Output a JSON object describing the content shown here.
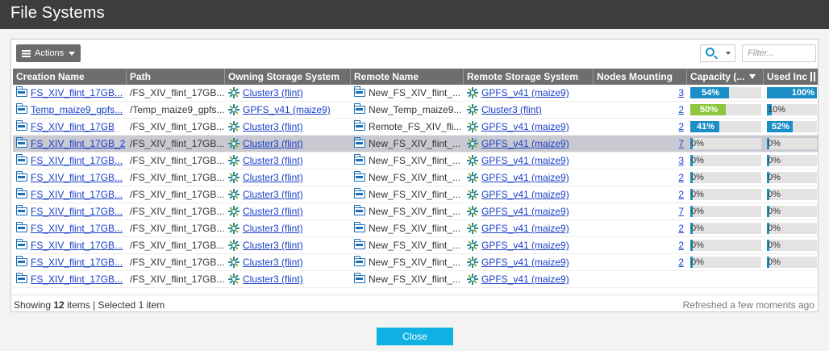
{
  "window": {
    "title": "File Systems"
  },
  "toolbar": {
    "actions_label": "Actions",
    "filter_placeholder": "Filter..."
  },
  "columns": [
    "Creation Name",
    "Path",
    "Owning Storage System",
    "Remote Name",
    "Remote Storage System",
    "Nodes Mounting",
    "Capacity (...",
    "Used Inc"
  ],
  "rows": [
    {
      "creation_name": "FS_XIV_flint_17GB...",
      "path": "/FS_XIV_flint_17GB...",
      "owning_system": "Cluster3 (flint)",
      "remote_name": "New_FS_XIV_flint_...",
      "remote_system": "GPFS_v41 (maize9)",
      "nodes_mounting": "3",
      "capacity_pct": 54,
      "capacity_label": "54%",
      "used_inc_pct": 100,
      "used_inc_label": "100%",
      "selected": false
    },
    {
      "creation_name": "Temp_maize9_gpfs...",
      "path": "/Temp_maize9_gpfs...",
      "owning_system": "GPFS_v41 (maize9)",
      "remote_name": "New_Temp_maize9...",
      "remote_system": "Cluster3 (flint)",
      "nodes_mounting": "2",
      "capacity_pct": 50,
      "capacity_label": "50%",
      "used_inc_pct": 10,
      "used_inc_label": "10%",
      "selected": false
    },
    {
      "creation_name": "FS_XIV_flint_17GB",
      "path": "/FS_XIV_flint_17GB...",
      "owning_system": "Cluster3 (flint)",
      "remote_name": "Remote_FS_XIV_fli...",
      "remote_system": "GPFS_v41 (maize9)",
      "nodes_mounting": "2",
      "capacity_pct": 41,
      "capacity_label": "41%",
      "used_inc_pct": 52,
      "used_inc_label": "52%",
      "selected": false
    },
    {
      "creation_name": "FS_XIV_flint_17GB_2",
      "path": "/FS_XIV_flint_17GB...",
      "owning_system": "Cluster3 (flint)",
      "remote_name": "New_FS_XIV_flint_...",
      "remote_system": "GPFS_v41 (maize9)",
      "nodes_mounting": "7",
      "capacity_pct": 2,
      "capacity_label": "0%",
      "used_inc_pct": 2,
      "used_inc_label": "0%",
      "selected": true
    },
    {
      "creation_name": "FS_XIV_flint_17GB...",
      "path": "/FS_XIV_flint_17GB...",
      "owning_system": "Cluster3 (flint)",
      "remote_name": "New_FS_XIV_flint_...",
      "remote_system": "GPFS_v41 (maize9)",
      "nodes_mounting": "3",
      "capacity_pct": 2,
      "capacity_label": "0%",
      "used_inc_pct": 2,
      "used_inc_label": "0%",
      "selected": false
    },
    {
      "creation_name": "FS_XIV_flint_17GB...",
      "path": "/FS_XIV_flint_17GB...",
      "owning_system": "Cluster3 (flint)",
      "remote_name": "New_FS_XIV_flint_...",
      "remote_system": "GPFS_v41 (maize9)",
      "nodes_mounting": "2",
      "capacity_pct": 2,
      "capacity_label": "0%",
      "used_inc_pct": 2,
      "used_inc_label": "0%",
      "selected": false
    },
    {
      "creation_name": "FS_XIV_flint_17GB...",
      "path": "/FS_XIV_flint_17GB...",
      "owning_system": "Cluster3 (flint)",
      "remote_name": "New_FS_XIV_flint_...",
      "remote_system": "GPFS_v41 (maize9)",
      "nodes_mounting": "2",
      "capacity_pct": 2,
      "capacity_label": "0%",
      "used_inc_pct": 2,
      "used_inc_label": "0%",
      "selected": false
    },
    {
      "creation_name": "FS_XIV_flint_17GB...",
      "path": "/FS_XIV_flint_17GB...",
      "owning_system": "Cluster3 (flint)",
      "remote_name": "New_FS_XIV_flint_...",
      "remote_system": "GPFS_v41 (maize9)",
      "nodes_mounting": "7",
      "capacity_pct": 2,
      "capacity_label": "0%",
      "used_inc_pct": 2,
      "used_inc_label": "0%",
      "selected": false
    },
    {
      "creation_name": "FS_XIV_flint_17GB...",
      "path": "/FS_XIV_flint_17GB...",
      "owning_system": "Cluster3 (flint)",
      "remote_name": "New_FS_XIV_flint_...",
      "remote_system": "GPFS_v41 (maize9)",
      "nodes_mounting": "2",
      "capacity_pct": 2,
      "capacity_label": "0%",
      "used_inc_pct": 2,
      "used_inc_label": "0%",
      "selected": false
    },
    {
      "creation_name": "FS_XIV_flint_17GB...",
      "path": "/FS_XIV_flint_17GB...",
      "owning_system": "Cluster3 (flint)",
      "remote_name": "New_FS_XIV_flint_...",
      "remote_system": "GPFS_v41 (maize9)",
      "nodes_mounting": "2",
      "capacity_pct": 2,
      "capacity_label": "0%",
      "used_inc_pct": 2,
      "used_inc_label": "0%",
      "selected": false
    },
    {
      "creation_name": "FS_XIV_flint_17GB...",
      "path": "/FS_XIV_flint_17GB...",
      "owning_system": "Cluster3 (flint)",
      "remote_name": "New_FS_XIV_flint_...",
      "remote_system": "GPFS_v41 (maize9)",
      "nodes_mounting": "2",
      "capacity_pct": 2,
      "capacity_label": "0%",
      "used_inc_pct": 2,
      "used_inc_label": "0%",
      "selected": false
    },
    {
      "creation_name": "FS_XIV_flint_17GB...",
      "path": "/FS_XIV_flint_17GB...",
      "owning_system": "Cluster3 (flint)",
      "remote_name": "New_FS_XIV_flint_...",
      "remote_system": "GPFS_v41 (maize9)",
      "nodes_mounting": "",
      "capacity_pct": null,
      "capacity_label": "",
      "used_inc_pct": null,
      "used_inc_label": "",
      "selected": false
    }
  ],
  "footer": {
    "showing_prefix": "Showing",
    "item_count": "12",
    "items_suffix": "items | Selected 1 item",
    "refreshed": "Refreshed a few moments ago"
  },
  "close_label": "Close",
  "colors": {
    "capacity_bar": "#1a8fc7",
    "capacity_bar_low": "#8ec63f",
    "used_bar": "#1a8fc7"
  }
}
